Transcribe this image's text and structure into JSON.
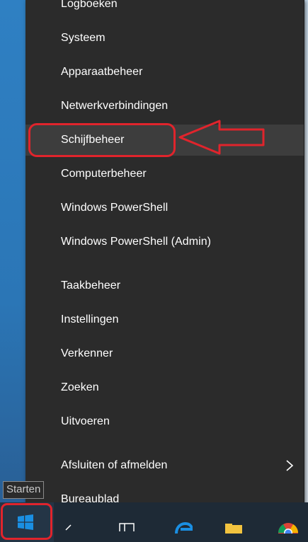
{
  "menu": {
    "items": [
      {
        "label": "Logboeken"
      },
      {
        "label": "Systeem"
      },
      {
        "label": "Apparaatbeheer"
      },
      {
        "label": "Netwerkverbindingen"
      },
      {
        "label": "Schijfbeheer"
      },
      {
        "label": "Computerbeheer"
      },
      {
        "label": "Windows PowerShell"
      },
      {
        "label": "Windows PowerShell (Admin)"
      },
      {
        "label": "Taakbeheer"
      },
      {
        "label": "Instellingen"
      },
      {
        "label": "Verkenner"
      },
      {
        "label": "Zoeken"
      },
      {
        "label": "Uitvoeren"
      },
      {
        "label": "Afsluiten of afmelden"
      },
      {
        "label": "Bureaublad"
      }
    ],
    "highlighted_item": "Schijfbeheer",
    "submenu_icon": "chevron-right-icon"
  },
  "taskbar": {
    "start_tooltip": "Starten",
    "start_icon": "windows-logo-icon",
    "icons": [
      "search-icon",
      "task-view-icon",
      "edge-icon",
      "file-explorer-icon",
      "chrome-icon"
    ]
  },
  "annotations": {
    "color": "#e0242c"
  },
  "colors": {
    "menu_background": "#2b2b2b",
    "menu_highlight": "#3d3d3d",
    "text": "#ffffff",
    "accent_blue": "#1a8fe3"
  }
}
